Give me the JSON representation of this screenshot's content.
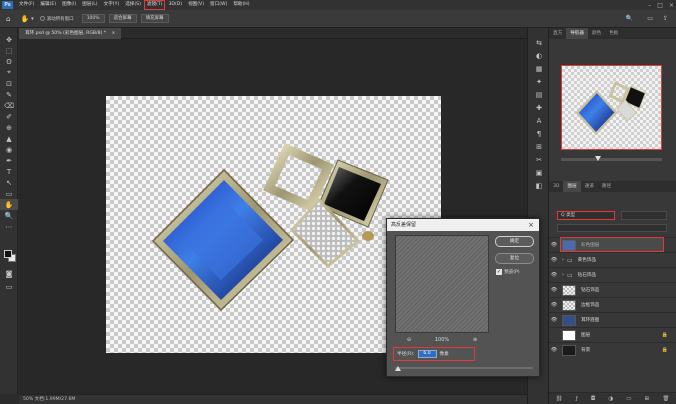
{
  "menubar": {
    "logo": "Ps",
    "items": [
      "文件(F)",
      "编辑(E)",
      "图像(I)",
      "图层(L)",
      "文字(Y)",
      "选择(S)",
      "滤镜(T)",
      "3D(D)",
      "视图(V)",
      "窗口(W)",
      "帮助(H)"
    ],
    "highlighted_index": 6,
    "window_controls": [
      "–",
      "□",
      "×"
    ]
  },
  "options": {
    "scroll_all": "滚动所有窗口",
    "zoom": "100%",
    "fit_screen": "适合屏幕",
    "fill_screen": "填充屏幕"
  },
  "tools": [
    "✥",
    "⬚",
    "ʘ",
    "⌖",
    "⊡",
    "✎",
    "⌫",
    "✐",
    "⊕",
    "▲",
    "◉",
    "✒",
    "T",
    "↖",
    "▭",
    "✋",
    "🔍",
    "⋯"
  ],
  "document": {
    "tab_label": "耳环.psd @ 50% (彩色图层, RGB/8) *",
    "close": "×"
  },
  "status": {
    "text": "50%   文档:1.99M/27.6M"
  },
  "mid_icons": [
    "⇆",
    "◐",
    "▦",
    "✦",
    "▤",
    "✚",
    "A",
    "¶",
    "⊞",
    "✂",
    "▣",
    "◧"
  ],
  "right_panel": {
    "top_tabs": [
      "直方",
      "导航器",
      "颜色",
      "色板"
    ],
    "top_active": 1,
    "layer_tabs": [
      "3D",
      "图层",
      "通道",
      "路径"
    ],
    "layer_active": 1,
    "kind_label": "Q 类型",
    "layers": [
      {
        "name": "彩色图层",
        "thumb": "#3a6bd6",
        "selected": true,
        "lock": ""
      },
      {
        "name": "黄色饰品",
        "thumb": "folder",
        "selected": false,
        "lock": ""
      },
      {
        "name": "钻石饰品",
        "thumb": "folder",
        "selected": false,
        "lock": ""
      },
      {
        "name": "钻石饰品",
        "thumb": "#9c9c9c",
        "selected": false,
        "lock": ""
      },
      {
        "name": "边框饰品",
        "thumb": "#9c9c9c",
        "selected": false,
        "lock": ""
      },
      {
        "name": "耳环底图",
        "thumb": "#334f8a",
        "selected": false,
        "lock": ""
      },
      {
        "name": "图层",
        "thumb": "#ffffff",
        "selected": false,
        "lock": "🔒"
      },
      {
        "name": "背景",
        "thumb": "#1b1b1b",
        "selected": false,
        "lock": "🔒"
      }
    ]
  },
  "dialog": {
    "title": "高反差保留",
    "ok": "确定",
    "reset": "复位",
    "preview_label": "预览(P)",
    "preview_checked": true,
    "zoom_out": "⊖",
    "zoom_value": "100%",
    "zoom_in": "⊕",
    "radius_label": "半径(R):",
    "radius_value": "6.0",
    "radius_unit": "像素"
  }
}
